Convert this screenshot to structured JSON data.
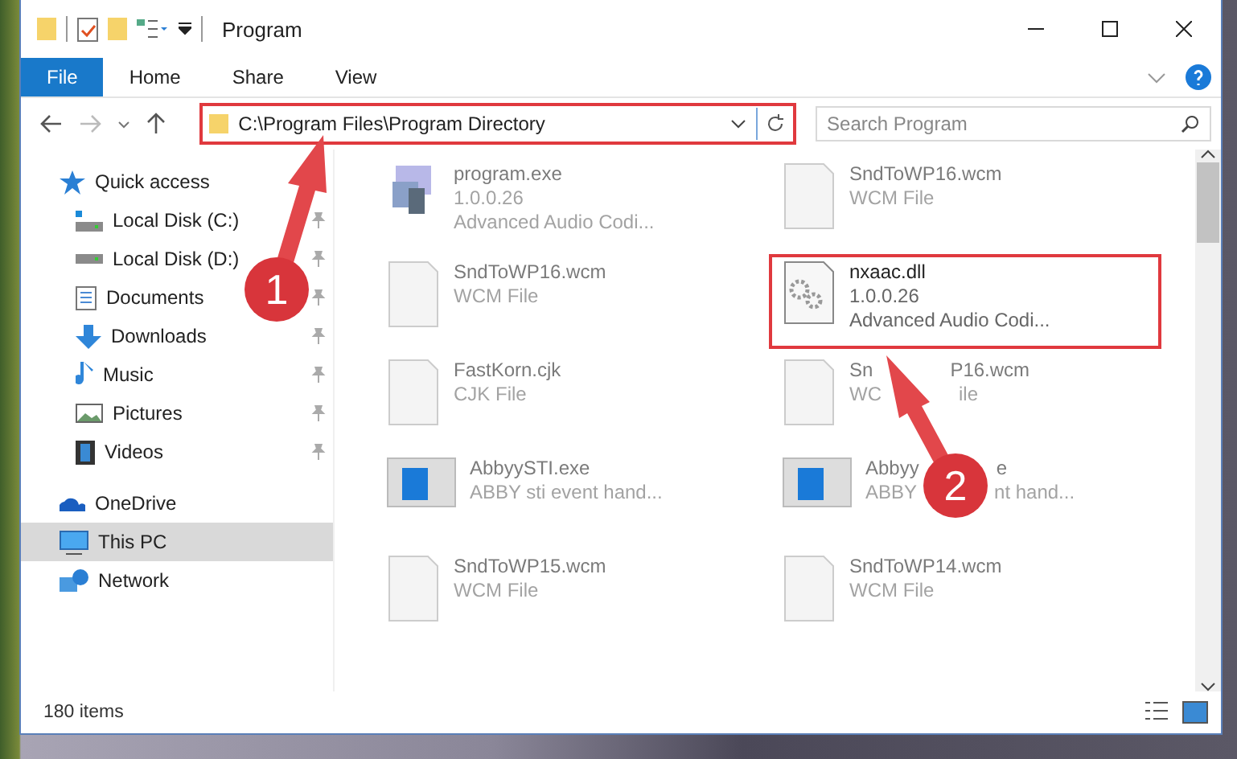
{
  "window": {
    "title": "Program"
  },
  "ribbon_tabs": [
    {
      "label": "File",
      "selected": true
    },
    {
      "label": "Home",
      "selected": false
    },
    {
      "label": "Share",
      "selected": false
    },
    {
      "label": "View",
      "selected": false
    }
  ],
  "address": {
    "path": "C:\\Program Files\\Program Directory"
  },
  "search": {
    "placeholder": "Search Program"
  },
  "sidebar": {
    "items": [
      {
        "label": "Quick access",
        "kind": "quick",
        "pinned": false,
        "selected": false,
        "children": [
          {
            "label": "Local Disk (C:)",
            "kind": "diskc",
            "pinned": true,
            "selected": false
          },
          {
            "label": "Local Disk (D:)",
            "kind": "disk",
            "pinned": true,
            "selected": false
          },
          {
            "label": "Documents",
            "kind": "doc",
            "pinned": true,
            "selected": false
          },
          {
            "label": "Downloads",
            "kind": "download",
            "pinned": true,
            "selected": false
          },
          {
            "label": "Music",
            "kind": "music",
            "pinned": true,
            "selected": false
          },
          {
            "label": "Pictures",
            "kind": "pictures",
            "pinned": true,
            "selected": false
          },
          {
            "label": "Videos",
            "kind": "videos",
            "pinned": true,
            "selected": false
          }
        ]
      },
      {
        "label": "OneDrive",
        "kind": "cloud",
        "pinned": false,
        "selected": false
      },
      {
        "label": "This PC",
        "kind": "pc",
        "pinned": false,
        "selected": true
      },
      {
        "label": "Network",
        "kind": "network",
        "pinned": false,
        "selected": false
      }
    ]
  },
  "files": [
    {
      "name": [
        "program.exe"
      ],
      "lines": [
        [
          "1.0.0.26"
        ],
        [
          "Advanced Audio Codi..."
        ]
      ],
      "kind": "exe",
      "highlighted": false
    },
    {
      "name": [
        "SndToWP16.wcm"
      ],
      "lines": [
        [
          "WCM File"
        ]
      ],
      "kind": "blank",
      "highlighted": false
    },
    {
      "name": [
        "SndToWP16.wcm"
      ],
      "lines": [
        [
          "WCM File"
        ]
      ],
      "kind": "blank",
      "highlighted": false
    },
    {
      "name": [
        "nxaac.dll"
      ],
      "lines": [
        [
          "1.0.0.26"
        ],
        [
          "Advanced Audio Codi..."
        ]
      ],
      "kind": "dll",
      "highlighted": true
    },
    {
      "name": [
        "FastKorn.cjk"
      ],
      "lines": [
        [
          "CJK File"
        ]
      ],
      "kind": "blank",
      "highlighted": false
    },
    {
      "name": [
        "Sn",
        "P16.wcm"
      ],
      "lines": [
        [
          "WC",
          "ile"
        ]
      ],
      "kind": "blank",
      "highlighted": false
    },
    {
      "name": [
        "AbbyySTI.exe"
      ],
      "lines": [
        [
          "ABBY sti event hand..."
        ]
      ],
      "kind": "app",
      "highlighted": false
    },
    {
      "name": [
        "Abbyy",
        "e"
      ],
      "lines": [
        [
          "ABBY",
          "nt hand..."
        ]
      ],
      "kind": "app",
      "highlighted": false
    },
    {
      "name": [
        "SndToWP15.wcm"
      ],
      "lines": [
        [
          "WCM File"
        ]
      ],
      "kind": "blank",
      "highlighted": false
    },
    {
      "name": [
        "SndToWP14.wcm"
      ],
      "lines": [
        [
          "WCM File"
        ]
      ],
      "kind": "blank",
      "highlighted": false
    }
  ],
  "status_bar": {
    "count": "180 items"
  },
  "annotations": [
    {
      "number": "1"
    },
    {
      "number": "2"
    }
  ]
}
